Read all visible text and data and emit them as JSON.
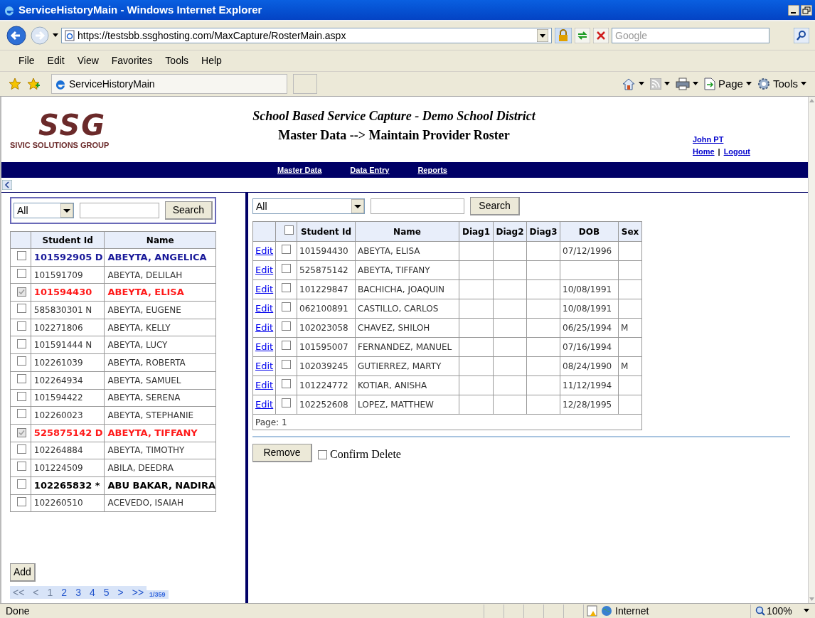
{
  "window": {
    "title": "ServiceHistoryMain - Windows Internet Explorer"
  },
  "address_bar": {
    "url": "https://testsbb.ssghosting.com/MaxCapture/RosterMain.aspx",
    "search_placeholder": "Google"
  },
  "menu": [
    "File",
    "Edit",
    "View",
    "Favorites",
    "Tools",
    "Help"
  ],
  "favorites_bar": {
    "tab": "ServiceHistoryMain",
    "tools": [
      {
        "kind": "home"
      },
      {
        "kind": "feeds"
      },
      {
        "kind": "print"
      },
      {
        "kind": "page",
        "label": "Page"
      },
      {
        "kind": "tools",
        "label": "Tools"
      }
    ]
  },
  "header": {
    "logo": "SSG",
    "company": "SIVIC SOLUTIONS GROUP",
    "title": "School Based Service Capture - Demo School District",
    "subtitle": "Master Data --> Maintain Provider Roster",
    "user": "John PT",
    "links": [
      "Home",
      "Logout"
    ],
    "separator": "|"
  },
  "nav": [
    "Master Data",
    "Data Entry",
    "Reports"
  ],
  "left_panel": {
    "filter": "All",
    "search_button": "Search",
    "columns": [
      "Student Id",
      "Name"
    ],
    "rows": [
      {
        "id": "101592905 D",
        "name": "ABEYTA, ANGELICA",
        "kind": "flagged",
        "checked": false
      },
      {
        "id": "101591709",
        "name": "ABEYTA, DELILAH",
        "kind": "normal",
        "checked": false
      },
      {
        "id": "101594430",
        "name": "ABEYTA, ELISA",
        "kind": "selected",
        "checked": true
      },
      {
        "id": "585830301 N",
        "name": "ABEYTA, EUGENE",
        "kind": "normal",
        "checked": false
      },
      {
        "id": "102271806",
        "name": "ABEYTA, KELLY",
        "kind": "normal",
        "checked": false
      },
      {
        "id": "101591444 N",
        "name": "ABEYTA, LUCY",
        "kind": "normal",
        "checked": false
      },
      {
        "id": "102261039",
        "name": "ABEYTA, ROBERTA",
        "kind": "normal",
        "checked": false
      },
      {
        "id": "102264934",
        "name": "ABEYTA, SAMUEL",
        "kind": "normal",
        "checked": false
      },
      {
        "id": "101594422",
        "name": "ABEYTA, SERENA",
        "kind": "normal",
        "checked": false
      },
      {
        "id": "102260023",
        "name": "ABEYTA, STEPHANIE",
        "kind": "normal",
        "checked": false
      },
      {
        "id": "525875142 D",
        "name": "ABEYTA, TIFFANY",
        "kind": "selected",
        "checked": true
      },
      {
        "id": "102264884",
        "name": "ABEYTA, TIMOTHY",
        "kind": "normal",
        "checked": false
      },
      {
        "id": "101224509",
        "name": "ABILA, DEEDRA",
        "kind": "normal",
        "checked": false
      },
      {
        "id": "102265832 *",
        "name": "ABU BAKAR, NADIRA",
        "kind": "new",
        "checked": false
      },
      {
        "id": "102260510",
        "name": "ACEVEDO, ISAIAH",
        "kind": "normal",
        "checked": false
      }
    ],
    "add_button": "Add",
    "pager": [
      {
        "label": "<<",
        "disabled": true
      },
      {
        "label": "<",
        "disabled": true
      },
      {
        "label": "1",
        "disabled": true
      },
      {
        "label": "2",
        "disabled": false
      },
      {
        "label": "3",
        "disabled": false
      },
      {
        "label": "4",
        "disabled": false
      },
      {
        "label": "5",
        "disabled": false
      },
      {
        "label": ">",
        "disabled": false
      },
      {
        "label": ">>",
        "disabled": false
      }
    ],
    "page_count": "1/359"
  },
  "right_panel": {
    "filter": "All",
    "search_button": "Search",
    "select_all_checked": false,
    "columns": [
      "Student Id",
      "Name",
      "Diag1",
      "Diag2",
      "Diag3",
      "DOB",
      "Sex"
    ],
    "rows": [
      {
        "edit": "Edit",
        "checked": false,
        "cells": [
          "101594430",
          "ABEYTA, ELISA",
          "",
          "",
          "",
          "07/12/1996",
          ""
        ]
      },
      {
        "edit": "Edit",
        "checked": false,
        "cells": [
          "525875142",
          "ABEYTA, TIFFANY",
          "",
          "",
          "",
          "",
          ""
        ]
      },
      {
        "edit": "Edit",
        "checked": false,
        "cells": [
          "101229847",
          "BACHICHA, JOAQUIN",
          "",
          "",
          "",
          "10/08/1991",
          ""
        ]
      },
      {
        "edit": "Edit",
        "checked": false,
        "cells": [
          "062100891",
          "CASTILLO, CARLOS",
          "",
          "",
          "",
          "10/08/1991",
          ""
        ]
      },
      {
        "edit": "Edit",
        "checked": false,
        "cells": [
          "102023058",
          "CHAVEZ, SHILOH",
          "",
          "",
          "",
          "06/25/1994",
          "M"
        ]
      },
      {
        "edit": "Edit",
        "checked": false,
        "cells": [
          "101595007",
          "FERNANDEZ, MANUEL",
          "",
          "",
          "",
          "07/16/1994",
          ""
        ]
      },
      {
        "edit": "Edit",
        "checked": false,
        "cells": [
          "102039245",
          "GUTIERREZ, MARTY",
          "",
          "",
          "",
          "08/24/1990",
          "M"
        ]
      },
      {
        "edit": "Edit",
        "checked": false,
        "cells": [
          "101224772",
          "KOTIAR, ANISHA",
          "",
          "",
          "",
          "11/12/1994",
          ""
        ]
      },
      {
        "edit": "Edit",
        "checked": false,
        "cells": [
          "102252608",
          "LOPEZ, MATTHEW",
          "",
          "",
          "",
          "12/28/1995",
          ""
        ]
      }
    ],
    "page": "Page: 1",
    "remove_button": "Remove",
    "confirm_delete": {
      "label": "Confirm Delete",
      "checked": false
    }
  },
  "status_bar": {
    "text": "Done",
    "zone": "Internet",
    "zoom": "100%"
  }
}
